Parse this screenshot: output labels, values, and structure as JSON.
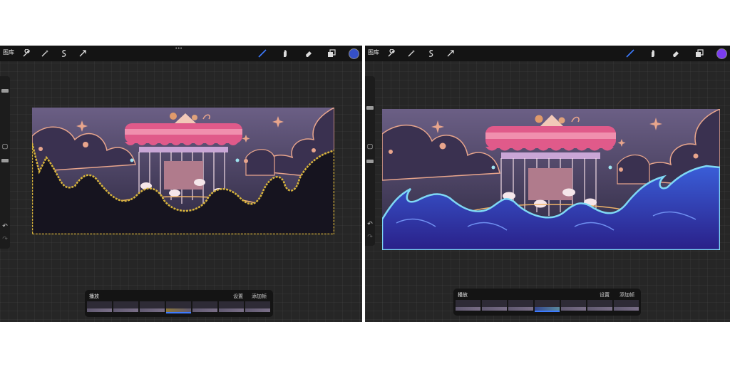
{
  "left_screen": {
    "toolbar": {
      "gallery_label": "图库",
      "left_tools": [
        "wrench-icon",
        "magic-wand-icon",
        "selection-icon",
        "transform-icon"
      ],
      "right_tools": [
        "brush-icon",
        "smudge-icon",
        "eraser-icon",
        "layers-icon"
      ],
      "color": "#3550c8",
      "more_dots": "•••"
    },
    "animation_assist": {
      "title": "播放",
      "settings": "设置",
      "add_frame": "添加帧",
      "frame_count": 7,
      "selected_frame": 4
    },
    "sidebar": {
      "undo_icon": "↶",
      "redo_icon": "↷"
    }
  },
  "right_screen": {
    "toolbar": {
      "gallery_label": "图库",
      "left_tools": [
        "wrench-icon",
        "magic-wand-icon",
        "selection-icon",
        "transform-icon"
      ],
      "right_tools": [
        "brush-icon",
        "smudge-icon",
        "eraser-icon",
        "layers-icon"
      ],
      "color": "#7a3cf0"
    },
    "animation_assist": {
      "title": "播放",
      "settings": "设置",
      "add_frame": "添加帧",
      "frame_count": 7,
      "selected_frame": 4
    },
    "sidebar": {
      "undo_icon": "↶",
      "redo_icon": "↷"
    }
  }
}
